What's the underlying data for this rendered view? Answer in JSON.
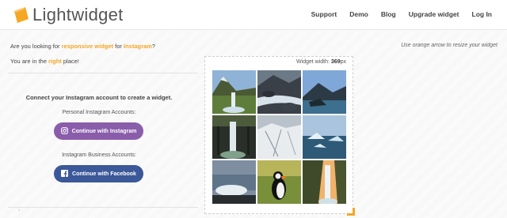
{
  "brand": {
    "name": "Lightwidget",
    "accent": "#f5a623"
  },
  "nav": [
    {
      "label": "Support"
    },
    {
      "label": "Demo"
    },
    {
      "label": "Blog"
    },
    {
      "label": "Upgrade widget"
    },
    {
      "label": "Log In"
    }
  ],
  "intro": {
    "line1_a": "Are you looking for ",
    "line1_hl1": "responsive widget",
    "line1_b": " for ",
    "line1_hl2": "Instagram",
    "line1_c": "?",
    "line2_a": "You are in the ",
    "line2_hl": "right",
    "line2_b": " place!",
    "hint": "Use orange arrow to resize your widget"
  },
  "connect": {
    "title": "Connect your Instagram account to create a widget.",
    "personal_label": "Personal Instagram Accounts:",
    "instagram_button": "Continue with Instagram",
    "business_label": "Instagram Business Accounts:",
    "facebook_button": "Continue with Facebook"
  },
  "widget": {
    "width_label": "Widget width: ",
    "width_value": "369",
    "width_unit": "px",
    "photos": [
      {
        "subject": "mountain-waterfall"
      },
      {
        "subject": "river-rocks"
      },
      {
        "subject": "coastal-mountain"
      },
      {
        "subject": "basalt-waterfall"
      },
      {
        "subject": "snowy-landscape"
      },
      {
        "subject": "glacier-lagoon"
      },
      {
        "subject": "ice-beach"
      },
      {
        "subject": "puffin"
      },
      {
        "subject": "seljalandsfoss-waterfall"
      }
    ]
  },
  "colors": {
    "instagram_button": "#8a5dab",
    "facebook_button": "#3b5898"
  }
}
